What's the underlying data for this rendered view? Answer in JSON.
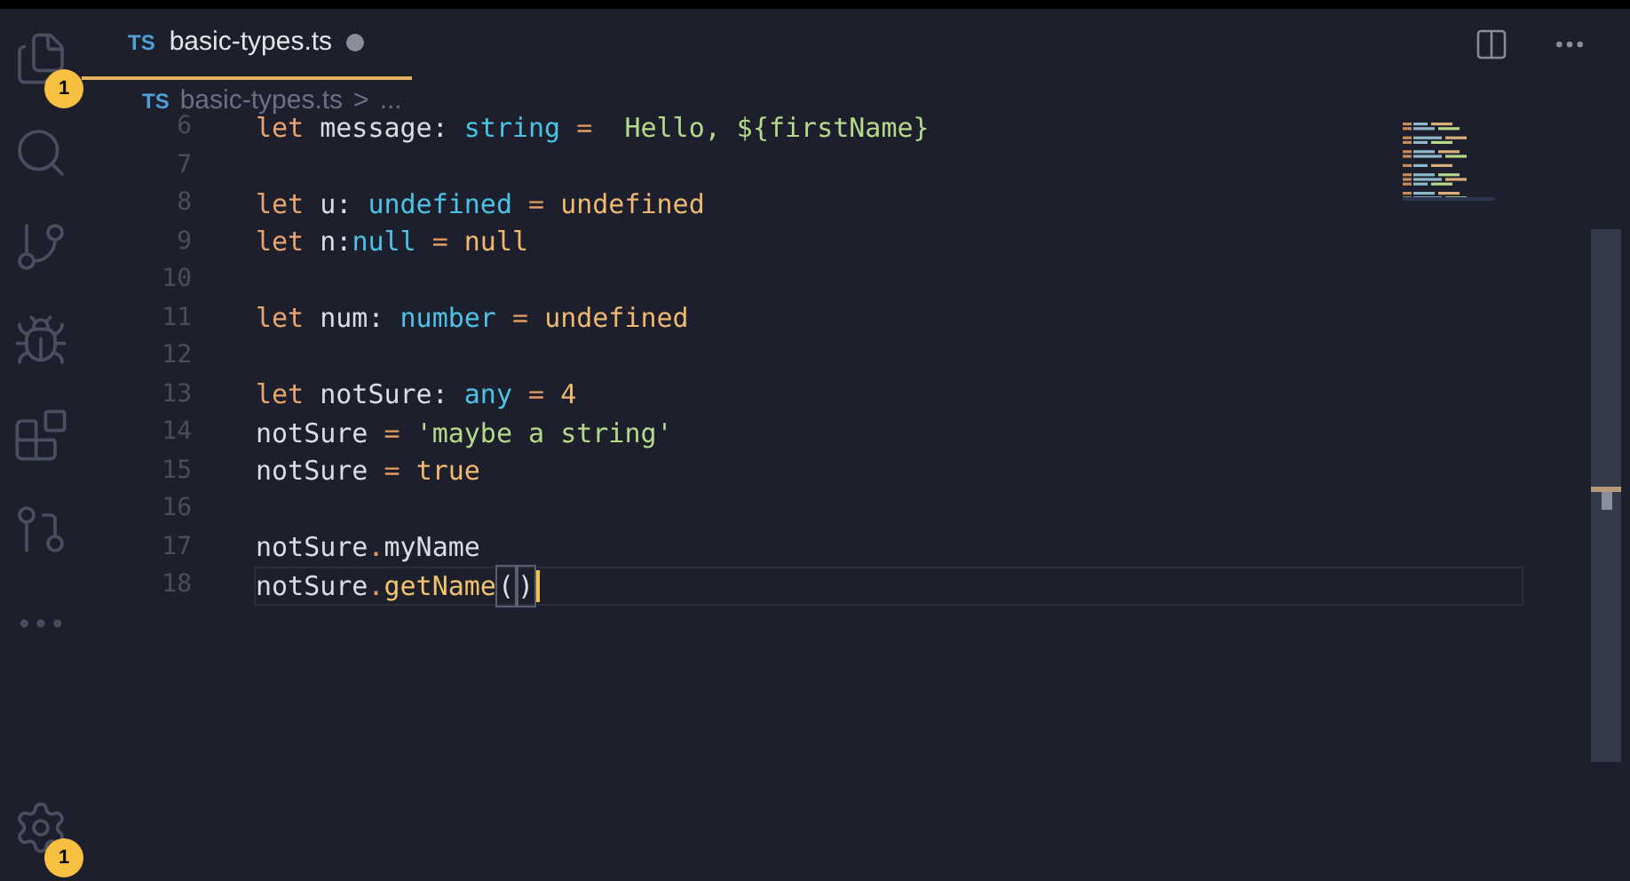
{
  "activity_bar": {
    "items": [
      {
        "kind": "files",
        "badge": "1"
      },
      {
        "kind": "search"
      },
      {
        "kind": "source-control"
      },
      {
        "kind": "debug"
      },
      {
        "kind": "extensions"
      },
      {
        "kind": "git-graph"
      },
      {
        "kind": "more"
      },
      {
        "kind": "settings",
        "badge": "1"
      }
    ]
  },
  "tabs": [
    {
      "lang": "TS",
      "label": "basic-types.ts",
      "modified": true,
      "selected": true
    }
  ],
  "breadcrumb": {
    "lang": "TS",
    "file": "basic-types.ts",
    "separator": ">",
    "more": "..."
  },
  "editor": {
    "lines": [
      {
        "number": "6",
        "current": false,
        "tokens": [
          {
            "kind": "keyword",
            "t": "let"
          },
          {
            "kind": "plain",
            "t": " message: "
          },
          {
            "kind": "type",
            "t": "string"
          },
          {
            "kind": "op",
            "t": " = "
          },
          {
            "kind": "string",
            "t": " Hello, ${firstName}"
          }
        ]
      },
      {
        "number": "7",
        "current": false
      },
      {
        "number": "8",
        "current": false,
        "tokens": [
          {
            "kind": "keyword",
            "t": "let"
          },
          {
            "kind": "plain",
            "t": " u: "
          },
          {
            "kind": "type",
            "t": "undefined"
          },
          {
            "kind": "op",
            "t": " = "
          },
          {
            "kind": "value",
            "t": "undefined"
          }
        ]
      },
      {
        "number": "9",
        "current": false,
        "tokens": [
          {
            "kind": "keyword",
            "t": "let"
          },
          {
            "kind": "plain",
            "t": " n:"
          },
          {
            "kind": "type",
            "t": "null"
          },
          {
            "kind": "op",
            "t": " = "
          },
          {
            "kind": "value",
            "t": "null"
          }
        ]
      },
      {
        "number": "10",
        "current": false
      },
      {
        "number": "11",
        "current": false,
        "tokens": [
          {
            "kind": "keyword",
            "t": "let"
          },
          {
            "kind": "plain",
            "t": " num: "
          },
          {
            "kind": "type",
            "t": "number"
          },
          {
            "kind": "op",
            "t": " = "
          },
          {
            "kind": "value",
            "t": "undefined"
          }
        ]
      },
      {
        "number": "12",
        "current": false
      },
      {
        "number": "13",
        "current": false,
        "tokens": [
          {
            "kind": "keyword",
            "t": "let"
          },
          {
            "kind": "plain",
            "t": " notSure: "
          },
          {
            "kind": "type",
            "t": "any"
          },
          {
            "kind": "op",
            "t": " = "
          },
          {
            "kind": "value",
            "t": "4"
          }
        ]
      },
      {
        "number": "14",
        "current": false,
        "tokens": [
          {
            "kind": "plain",
            "t": "notSure"
          },
          {
            "kind": "op",
            "t": " = "
          },
          {
            "kind": "string",
            "t": "'maybe a string'"
          }
        ]
      },
      {
        "number": "15",
        "current": false,
        "tokens": [
          {
            "kind": "plain",
            "t": "notSure"
          },
          {
            "kind": "op",
            "t": " = "
          },
          {
            "kind": "value",
            "t": "true"
          }
        ]
      },
      {
        "number": "16",
        "current": false
      },
      {
        "number": "17",
        "current": false,
        "tokens": [
          {
            "kind": "plain",
            "t": "notSure"
          },
          {
            "kind": "op",
            "t": "."
          },
          {
            "kind": "plain",
            "t": "myName"
          }
        ]
      },
      {
        "number": "18",
        "current": true,
        "tokens": [
          {
            "kind": "plain",
            "t": "notSure"
          },
          {
            "kind": "op",
            "t": "."
          },
          {
            "kind": "method",
            "t": "getName"
          },
          {
            "kind": "bracket",
            "t": "("
          },
          {
            "kind": "bracket",
            "t": ")"
          }
        ]
      }
    ]
  }
}
